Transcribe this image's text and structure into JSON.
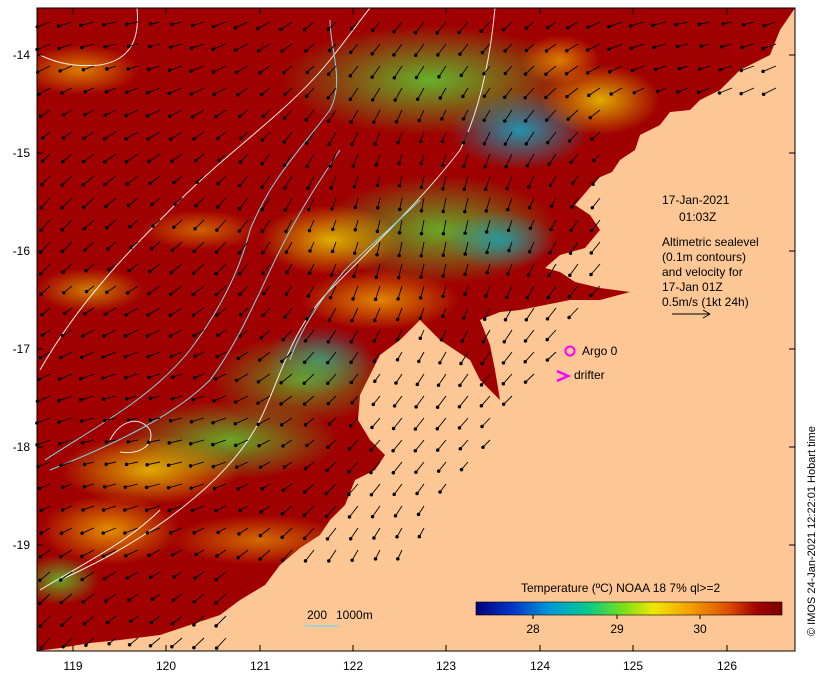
{
  "timestamp": {
    "date": "17-Jan-2021",
    "time": "01:03Z"
  },
  "description_lines": [
    "Altimetric sealevel",
    "(0.1m contours)",
    "and velocity for",
    "17-Jan 01Z",
    "0.5m/s (1kt 24h)"
  ],
  "legend": {
    "argo": "Argo 0",
    "drifter": "drifter"
  },
  "colorbar": {
    "title": "Temperature (ºC) NOAA 18 7% ql>=2",
    "ticks": [
      "28",
      "29",
      "30"
    ],
    "colors": [
      "#00007a",
      "#0036c8",
      "#0098d8",
      "#00c890",
      "#78e018",
      "#f0e800",
      "#f4a000",
      "#e05000",
      "#a00000",
      "#7a0000"
    ]
  },
  "depth_key": {
    "shallow": "200",
    "deep": "1000m"
  },
  "axes": {
    "x_ticks": [
      "119",
      "120",
      "121",
      "122",
      "123",
      "124",
      "125",
      "126"
    ],
    "y_ticks": [
      "-14",
      "-15",
      "-16",
      "-17",
      "-18",
      "-19"
    ]
  },
  "credit": "© IMOS 24-Jan-2021 12:22:01 Hobart time",
  "colors": {
    "land": "#fcc794",
    "sst_background": "#a00000",
    "isobath": "#7fd8e8",
    "markers": "#ff00ff"
  }
}
